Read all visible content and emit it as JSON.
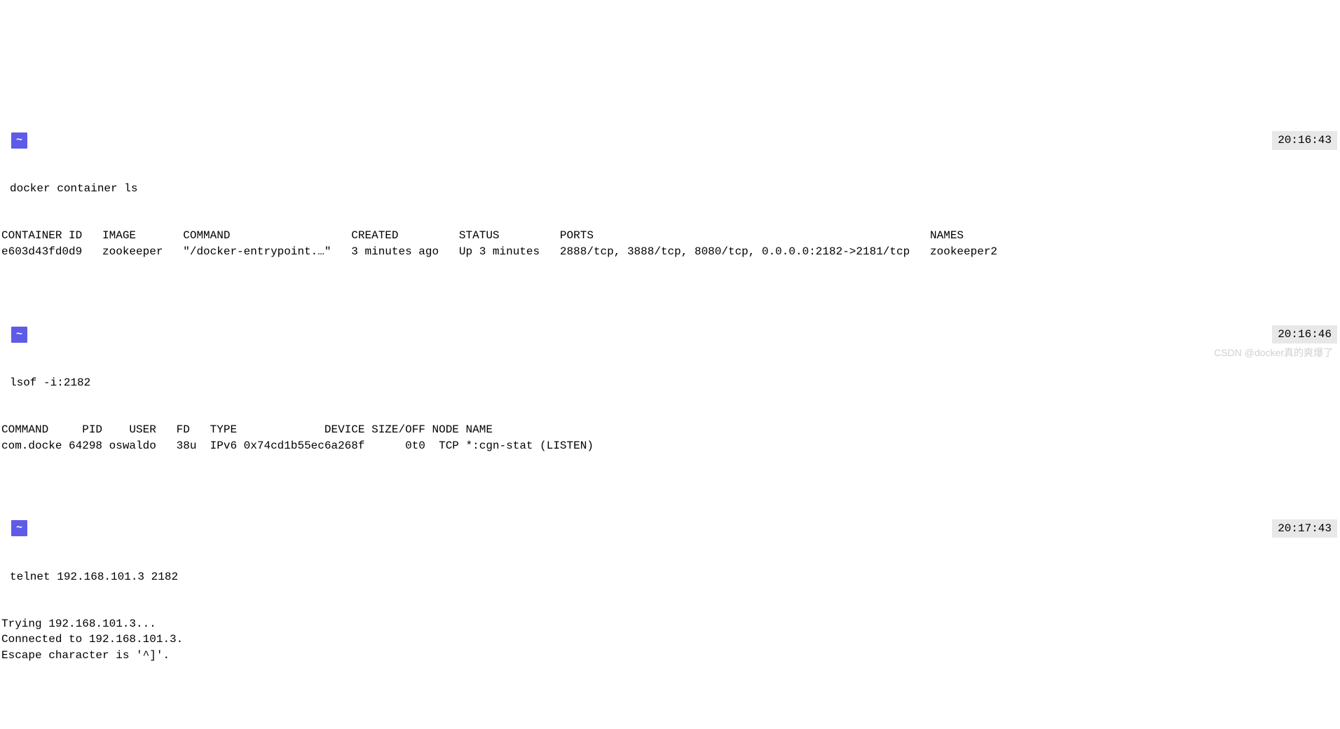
{
  "blocks": [
    {
      "prompt_icon": "",
      "tilde": "~",
      "timestamp": "20:16:43",
      "command": "docker container ls",
      "output": "CONTAINER ID   IMAGE       COMMAND                  CREATED         STATUS         PORTS                                                  NAMES\ne603d43fd0d9   zookeeper   \"/docker-entrypoint.…\"   3 minutes ago   Up 3 minutes   2888/tcp, 3888/tcp, 8080/tcp, 0.0.0.0:2182->2181/tcp   zookeeper2\n"
    },
    {
      "prompt_icon": "",
      "tilde": "~",
      "timestamp": "20:16:46",
      "command": "lsof -i:2182",
      "output": "COMMAND     PID    USER   FD   TYPE             DEVICE SIZE/OFF NODE NAME\ncom.docke 64298 oswaldo   38u  IPv6 0x74cd1b55ec6a268f      0t0  TCP *:cgn-stat (LISTEN)\n"
    },
    {
      "prompt_icon": "",
      "tilde": "~",
      "timestamp": "20:17:43",
      "command": "telnet 192.168.101.3 2182",
      "output": "Trying 192.168.101.3...\nConnected to 192.168.101.3.\nEscape character is '^]'."
    }
  ],
  "watermark": "CSDN @docker真的爽爆了"
}
